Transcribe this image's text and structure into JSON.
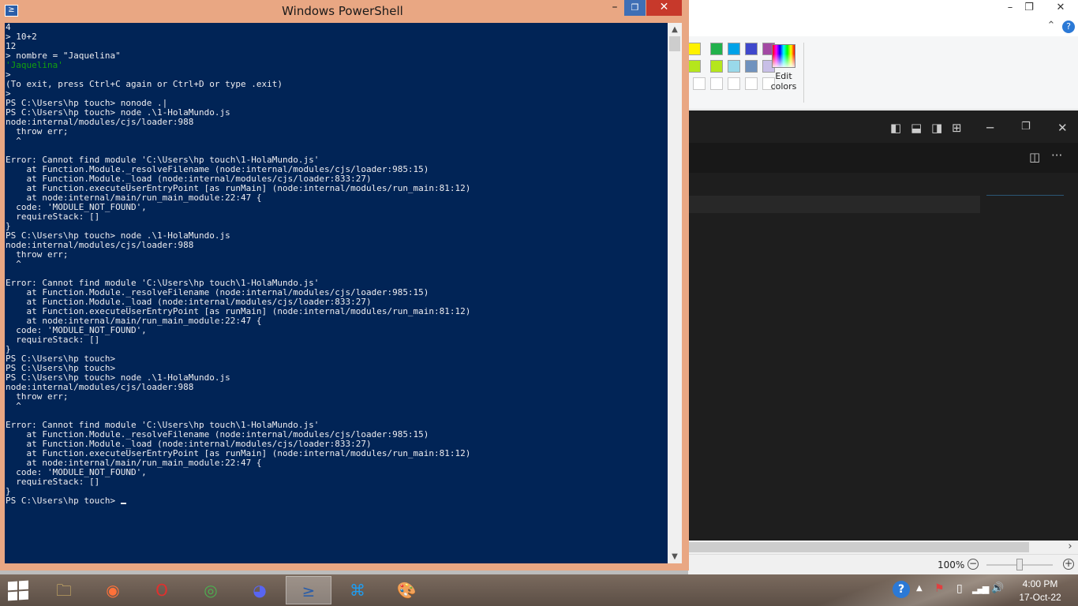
{
  "powershell": {
    "title": "Windows PowerShell",
    "minimize_glyph": "–",
    "restore_glyph": "❐",
    "close_glyph": "✕",
    "lines": [
      {
        "text": "4"
      },
      {
        "text": "> 10+2"
      },
      {
        "text": "12"
      },
      {
        "text": "> nombre = \"Jaquelina\""
      },
      {
        "text": "'Jaquelina'",
        "color": "green"
      },
      {
        "text": ">"
      },
      {
        "text": "(To exit, press Ctrl+C again or Ctrl+D or type .exit)"
      },
      {
        "text": ">"
      },
      {
        "text": "PS C:\\Users\\hp touch> nonode .|"
      },
      {
        "text": "PS C:\\Users\\hp touch> node .\\1-HolaMundo.js"
      },
      {
        "text": "node:internal/modules/cjs/loader:988"
      },
      {
        "text": "  throw err;"
      },
      {
        "text": "  ^"
      },
      {
        "text": ""
      },
      {
        "text": "Error: Cannot find module 'C:\\Users\\hp touch\\1-HolaMundo.js'"
      },
      {
        "text": "    at Function.Module._resolveFilename (node:internal/modules/cjs/loader:985:15)"
      },
      {
        "text": "    at Function.Module._load (node:internal/modules/cjs/loader:833:27)"
      },
      {
        "text": "    at Function.executeUserEntryPoint [as runMain] (node:internal/modules/run_main:81:12)"
      },
      {
        "text": "    at node:internal/main/run_main_module:22:47 {"
      },
      {
        "text": "  code: 'MODULE_NOT_FOUND',"
      },
      {
        "text": "  requireStack: []"
      },
      {
        "text": "}"
      },
      {
        "text": "PS C:\\Users\\hp touch> node .\\1-HolaMundo.js"
      },
      {
        "text": "node:internal/modules/cjs/loader:988"
      },
      {
        "text": "  throw err;"
      },
      {
        "text": "  ^"
      },
      {
        "text": ""
      },
      {
        "text": "Error: Cannot find module 'C:\\Users\\hp touch\\1-HolaMundo.js'"
      },
      {
        "text": "    at Function.Module._resolveFilename (node:internal/modules/cjs/loader:985:15)"
      },
      {
        "text": "    at Function.Module._load (node:internal/modules/cjs/loader:833:27)"
      },
      {
        "text": "    at Function.executeUserEntryPoint [as runMain] (node:internal/modules/run_main:81:12)"
      },
      {
        "text": "    at node:internal/main/run_main_module:22:47 {"
      },
      {
        "text": "  code: 'MODULE_NOT_FOUND',"
      },
      {
        "text": "  requireStack: []"
      },
      {
        "text": "}"
      },
      {
        "text": "PS C:\\Users\\hp touch>"
      },
      {
        "text": "PS C:\\Users\\hp touch>"
      },
      {
        "text": "PS C:\\Users\\hp touch> node .\\1-HolaMundo.js"
      },
      {
        "text": "node:internal/modules/cjs/loader:988"
      },
      {
        "text": "  throw err;"
      },
      {
        "text": "  ^"
      },
      {
        "text": ""
      },
      {
        "text": "Error: Cannot find module 'C:\\Users\\hp touch\\1-HolaMundo.js'"
      },
      {
        "text": "    at Function.Module._resolveFilename (node:internal/modules/cjs/loader:985:15)"
      },
      {
        "text": "    at Function.Module._load (node:internal/modules/cjs/loader:833:27)"
      },
      {
        "text": "    at Function.executeUserEntryPoint [as runMain] (node:internal/modules/run_main:81:12)"
      },
      {
        "text": "    at node:internal/main/run_main_module:22:47 {"
      },
      {
        "text": "  code: 'MODULE_NOT_FOUND',"
      },
      {
        "text": "  requireStack: []"
      },
      {
        "text": "}"
      }
    ],
    "prompt": "PS C:\\Users\\hp touch> ",
    "scroll_up_glyph": "▲",
    "scroll_down_glyph": "▼"
  },
  "paint": {
    "minimize_glyph": "–",
    "restore_glyph": "❐",
    "close_glyph": "✕",
    "collapse_glyph": "⌃",
    "help_glyph": "?",
    "palette_row1": [
      "#fff200",
      "#22b14c",
      "#00a2e8",
      "#3f48cc",
      "#a349a4"
    ],
    "palette_row2": [
      "#b5e61d",
      "#b5e61d",
      "#99d9ea",
      "#7092be",
      "#c8bfe7"
    ],
    "edit_colors_label_1": "Edit",
    "edit_colors_label_2": "colors",
    "zoom_level": "100%",
    "zoom_minus": "−",
    "zoom_plus": "+",
    "scroll_right_glyph": "›"
  },
  "vscode": {
    "min_glyph": "─",
    "max_glyph": "❐",
    "close_glyph": "✕",
    "more_glyph": "···"
  },
  "taskbar": {
    "apps": [
      {
        "name": "file-explorer",
        "glyph": "🗀",
        "color": "#e8c46a"
      },
      {
        "name": "firefox",
        "glyph": "◉",
        "color": "#ff7139"
      },
      {
        "name": "opera",
        "glyph": "O",
        "color": "#e0302e"
      },
      {
        "name": "chrome",
        "glyph": "◎",
        "color": "#4caf50"
      },
      {
        "name": "discord",
        "glyph": "◕",
        "color": "#5865f2"
      },
      {
        "name": "powershell",
        "glyph": "≥",
        "color": "#2b5ea8",
        "active": true
      },
      {
        "name": "vscode",
        "glyph": "⌘",
        "color": "#1f9cf0"
      },
      {
        "name": "paint",
        "glyph": "🎨",
        "color": "#e0e0e0"
      }
    ],
    "tray": {
      "help": "?",
      "chevron": "▲",
      "flag": "⚑",
      "battery": "▯",
      "signal": "▂▄▆",
      "volume": "🔊"
    },
    "clock_time": "4:00 PM",
    "clock_date": "17-Oct-22"
  }
}
